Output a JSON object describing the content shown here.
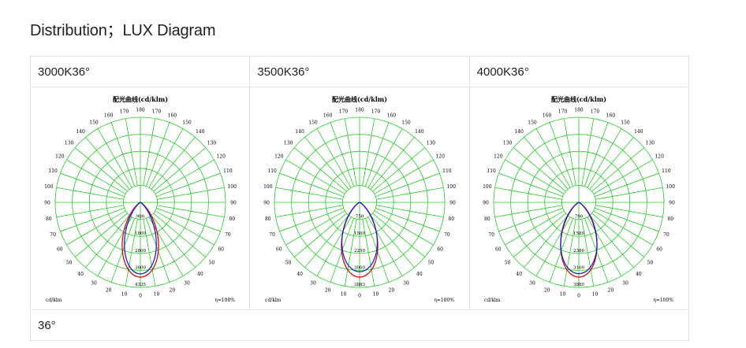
{
  "page": {
    "heading": "Distribution；LUX Diagram"
  },
  "table": {
    "columns": [
      {
        "label": "3000K36°"
      },
      {
        "label": "3500K36°"
      },
      {
        "label": "4000K36°"
      }
    ],
    "footer_label": "36°"
  },
  "chart_data": [
    {
      "type": "polar",
      "title": "配光曲线(cd/klm)",
      "unit_label": "cd/klm",
      "efficiency_label": "η=100%",
      "angle_labels": [
        "180",
        "170",
        "170",
        "160",
        "160",
        "150",
        "150",
        "140",
        "140",
        "130",
        "130",
        "120",
        "120",
        "110",
        "110",
        "100",
        "100",
        "90",
        "90",
        "80",
        "80",
        "70",
        "70",
        "60",
        "60",
        "50",
        "50",
        "40",
        "40",
        "30",
        "30",
        "20",
        "20",
        "10",
        "10",
        "0"
      ],
      "radial_labels": [
        "900",
        "1800",
        "2800",
        "3600",
        "4335"
      ],
      "max_value": 4335,
      "colors": {
        "grid": "#22cc22",
        "c0": "#cc1111",
        "c90": "#2222cc"
      },
      "series": [
        {
          "beam_deg": 36,
          "peak": 4335
        },
        {
          "beam_deg": 30,
          "peak": 4150
        }
      ]
    },
    {
      "type": "polar",
      "title": "配光曲线(cd/klm)",
      "unit_label": "cd/klm",
      "efficiency_label": "η=100%",
      "angle_labels": [
        "180",
        "170",
        "170",
        "160",
        "160",
        "150",
        "150",
        "140",
        "140",
        "130",
        "130",
        "120",
        "120",
        "110",
        "110",
        "100",
        "100",
        "90",
        "90",
        "80",
        "80",
        "70",
        "70",
        "60",
        "60",
        "50",
        "50",
        "40",
        "40",
        "30",
        "30",
        "20",
        "20",
        "10",
        "10",
        "0"
      ],
      "radial_labels": [
        "750",
        "1500",
        "2250",
        "3000",
        "3883"
      ],
      "max_value": 3883,
      "colors": {
        "grid": "#22cc22",
        "c0": "#cc1111",
        "c90": "#2222cc"
      },
      "series": [
        {
          "beam_deg": 36,
          "peak": 3883
        },
        {
          "beam_deg": 40,
          "peak": 3600
        }
      ]
    },
    {
      "type": "polar",
      "title": "配光曲线(cd/klm)",
      "unit_label": "cd/klm",
      "efficiency_label": "η=100%",
      "angle_labels": [
        "180",
        "170",
        "170",
        "160",
        "160",
        "150",
        "150",
        "140",
        "140",
        "130",
        "130",
        "120",
        "120",
        "110",
        "110",
        "100",
        "100",
        "90",
        "90",
        "80",
        "80",
        "70",
        "70",
        "60",
        "60",
        "50",
        "50",
        "40",
        "40",
        "30",
        "30",
        "20",
        "20",
        "10",
        "10",
        "0"
      ],
      "radial_labels": [
        "790",
        "1580",
        "2380",
        "3100",
        "3880"
      ],
      "max_value": 3880,
      "colors": {
        "grid": "#22cc22",
        "c0": "#cc1111",
        "c90": "#2222cc"
      },
      "series": [
        {
          "beam_deg": 36,
          "peak": 3880
        },
        {
          "beam_deg": 40,
          "peak": 3700
        }
      ]
    }
  ]
}
